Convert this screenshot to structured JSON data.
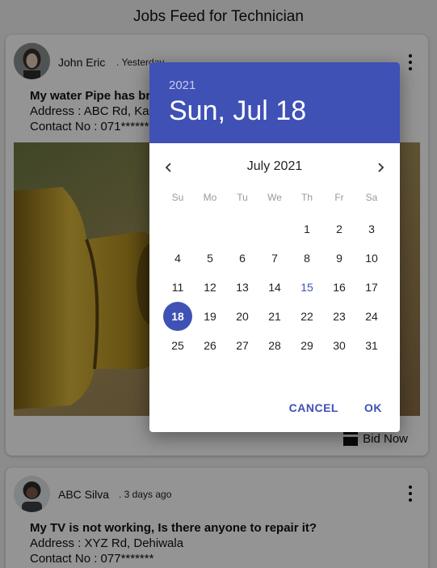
{
  "page": {
    "title": "Jobs Feed for Technician"
  },
  "posts": [
    {
      "user": "John Eric",
      "time": ". Yesterday",
      "title": "My water Pipe has broken, Is there anyone to repair it?",
      "address": "Address : ABC Rd, Kadawatha",
      "contact": "Contact No : 071*******",
      "bid_label": "Bid Now"
    },
    {
      "user": "ABC Silva",
      "time": ". 3 days ago",
      "title": "My TV is not working, Is there anyone to repair it?",
      "address": "Address : XYZ Rd, Dehiwala",
      "contact": "Contact No : 077*******"
    }
  ],
  "date_picker": {
    "year": "2021",
    "selected_label": "Sun, Jul 18",
    "month_label": "July 2021",
    "weekdays": [
      "Su",
      "Mo",
      "Tu",
      "We",
      "Th",
      "Fr",
      "Sa"
    ],
    "days": [
      "",
      "",
      "",
      "",
      "1",
      "2",
      "3",
      "4",
      "5",
      "6",
      "7",
      "8",
      "9",
      "10",
      "11",
      "12",
      "13",
      "14",
      "15",
      "16",
      "17",
      "18",
      "19",
      "20",
      "21",
      "22",
      "23",
      "24",
      "25",
      "26",
      "27",
      "28",
      "29",
      "30",
      "31"
    ],
    "today": "15",
    "selected": "18",
    "cancel_label": "CANCEL",
    "ok_label": "OK",
    "accent_color": "#3f51b5"
  },
  "icons": {
    "prev": "chevron-left-icon",
    "next": "chevron-right-icon",
    "more": "more-vertical-icon",
    "bid": "bid-icon"
  }
}
